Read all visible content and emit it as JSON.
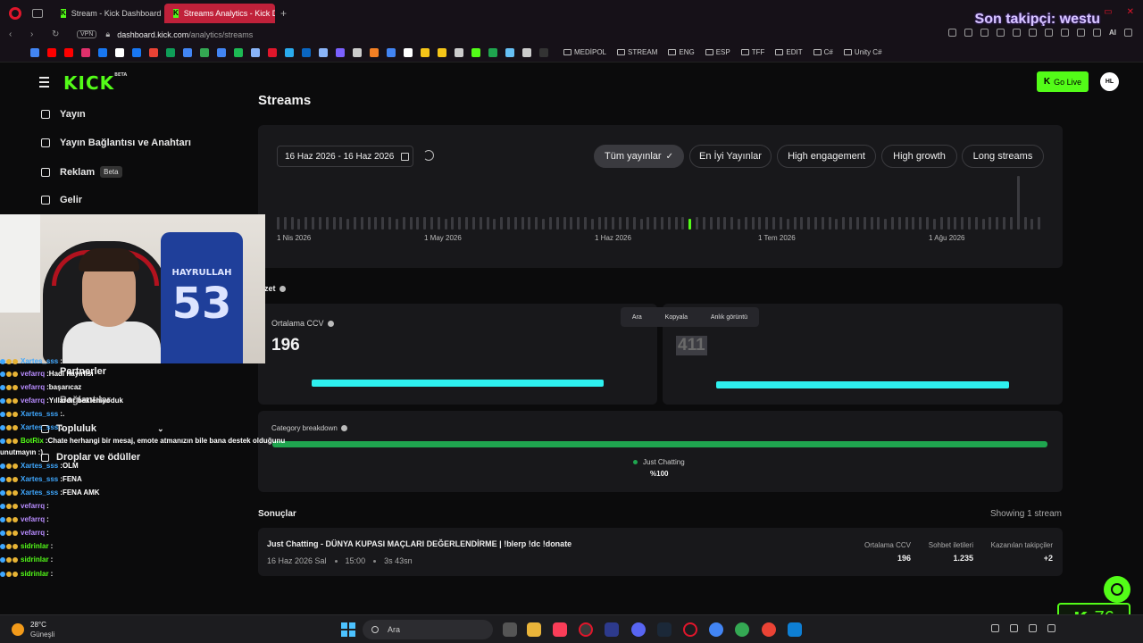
{
  "browser": {
    "tabs": [
      {
        "label": "Stream - Kick Dashboard",
        "favicon": "K",
        "active": false
      },
      {
        "label": "Streams Analytics - Kick D",
        "favicon": "K",
        "active": true
      }
    ],
    "new_tab_label": "+",
    "url_host": "dashboard.kick.com",
    "url_path": "/analytics/streams",
    "vpn_label": "VPN",
    "bookmark_folders": [
      "MEDİPOL",
      "STREAM",
      "ENG",
      "ESP",
      "TFF",
      "EDIT",
      "C#",
      "Unity C#"
    ],
    "bookmark_colors": [
      "#4285f4",
      "#ff0000",
      "#ff0000",
      "#e1306c",
      "#1877f2",
      "#ffffff",
      "#1877f2",
      "#ea4335",
      "#0f9d58",
      "#4285f4",
      "#34a853",
      "#4285f4",
      "#1db954",
      "#8ab4f8",
      "#e0162b",
      "#2aabee",
      "#0a66c2",
      "#8ab4f8",
      "#7b61ff",
      "#cccccc",
      "#f48024",
      "#4285f4",
      "#ffffff",
      "#f5c518",
      "#f5c518",
      "#cccccc",
      "#53fc18",
      "#1fa54f",
      "#66c0f4",
      "#cccccc",
      "#333333"
    ],
    "extra_menu": "AI"
  },
  "overlay": {
    "follower_text": "Son takipçi: westu",
    "viewer_count": "76",
    "viewer_icon": "K"
  },
  "header": {
    "logo": "KICK",
    "logo_badge": "BETA",
    "go_live_label": "Go Live",
    "avatar_initials": "HL"
  },
  "sidebar": {
    "items": [
      {
        "label": "Yayın",
        "icon": "broadcast-icon"
      },
      {
        "label": "Yayın Bağlantısı ve Anahtarı",
        "icon": "link-icon"
      },
      {
        "label": "Reklam",
        "icon": "ad-icon",
        "badge": "Beta"
      },
      {
        "label": "Gelir",
        "icon": "revenue-icon"
      },
      {
        "label": "Partnerler",
        "icon": "partner-icon"
      },
      {
        "label": "Bağlantılar",
        "icon": "share-icon"
      },
      {
        "label": "Topluluk",
        "icon": "community-icon"
      },
      {
        "label": "Droplar ve ödüller",
        "icon": "gift-icon"
      }
    ]
  },
  "webcam": {
    "jersey_name": "HAYRULLAH",
    "jersey_number": "53"
  },
  "chat": [
    {
      "user": "Xartes_sss",
      "color": "#3fa8ff",
      "text": ""
    },
    {
      "user": "vefarrq",
      "color": "#b88cff",
      "text": "Hadi hayırlısı"
    },
    {
      "user": "vefarrq",
      "color": "#b88cff",
      "text": "başarıcaz"
    },
    {
      "user": "vefarrq",
      "color": "#b88cff",
      "text": "Yıllardır bekleniyoduk"
    },
    {
      "user": "Xartes_sss",
      "color": "#3fa8ff",
      "text": "."
    },
    {
      "user": "Xartes_sss",
      "color": "#3fa8ff",
      "text": "."
    },
    {
      "user": "BotRix",
      "color": "#53fc18",
      "text": "Chate herhangi bir mesaj, emote atmanızın bile bana destek olduğunu"
    },
    {
      "user": "",
      "color": "#ffffff",
      "text": "unutmayın :)"
    },
    {
      "user": "Xartes_sss",
      "color": "#3fa8ff",
      "text": "OLM"
    },
    {
      "user": "Xartes_sss",
      "color": "#3fa8ff",
      "text": "FENA"
    },
    {
      "user": "Xartes_sss",
      "color": "#3fa8ff",
      "text": "FENA AMK"
    },
    {
      "user": "vefarrq",
      "color": "#b88cff",
      "text": ""
    },
    {
      "user": "vefarrq",
      "color": "#b88cff",
      "text": ""
    },
    {
      "user": "vefarrq",
      "color": "#b88cff",
      "text": ""
    },
    {
      "user": "sidrinlar",
      "color": "#53fc18",
      "text": ""
    },
    {
      "user": "sidrinlar",
      "color": "#53fc18",
      "text": ""
    },
    {
      "user": "sidrinlar",
      "color": "#53fc18",
      "text": ""
    }
  ],
  "page": {
    "title": "Streams",
    "date_range": "16 Haz 2026 - 16 Haz 2026",
    "filters": [
      {
        "label": "Tüm yayınlar",
        "active": true
      },
      {
        "label": "En İyi Yayınlar",
        "active": false
      },
      {
        "label": "High engagement",
        "active": false
      },
      {
        "label": "High growth",
        "active": false
      },
      {
        "label": "Long streams",
        "active": false
      }
    ],
    "timeline_labels": [
      "1 Nis 2026",
      "1 May 2026",
      "1 Haz 2026",
      "1 Tem 2026",
      "1 Ağu 2026"
    ],
    "summary_title": "Özet",
    "stats": [
      {
        "label": "Ortalama CCV",
        "value": "196"
      },
      {
        "label": "",
        "value": "411"
      }
    ],
    "context_menu": [
      "Ara",
      "Kopyala",
      "Anlık görüntü"
    ],
    "category_title": "Category breakdown",
    "category": {
      "name": "Just Chatting",
      "percent": "%100",
      "share": 1.0
    },
    "results_title": "Sonuçlar",
    "results_count": "Showing 1 stream",
    "stream": {
      "title": "Just Chatting - DÜNYA KUPASI MAÇLARI DEĞERLENDİRME | !blerp !dc !donate",
      "date": "16 Haz 2026 Sal",
      "time": "15:00",
      "duration": "3s 43sn",
      "columns": [
        {
          "header": "Ortalama CCV",
          "value": "196"
        },
        {
          "header": "Sohbet iletileri",
          "value": "1.235"
        },
        {
          "header": "Kazanılan takipçiler",
          "value": "+2"
        }
      ]
    }
  },
  "taskbar": {
    "weather_temp": "28°C",
    "weather_desc": "Güneşli",
    "search_placeholder": "Ara"
  }
}
